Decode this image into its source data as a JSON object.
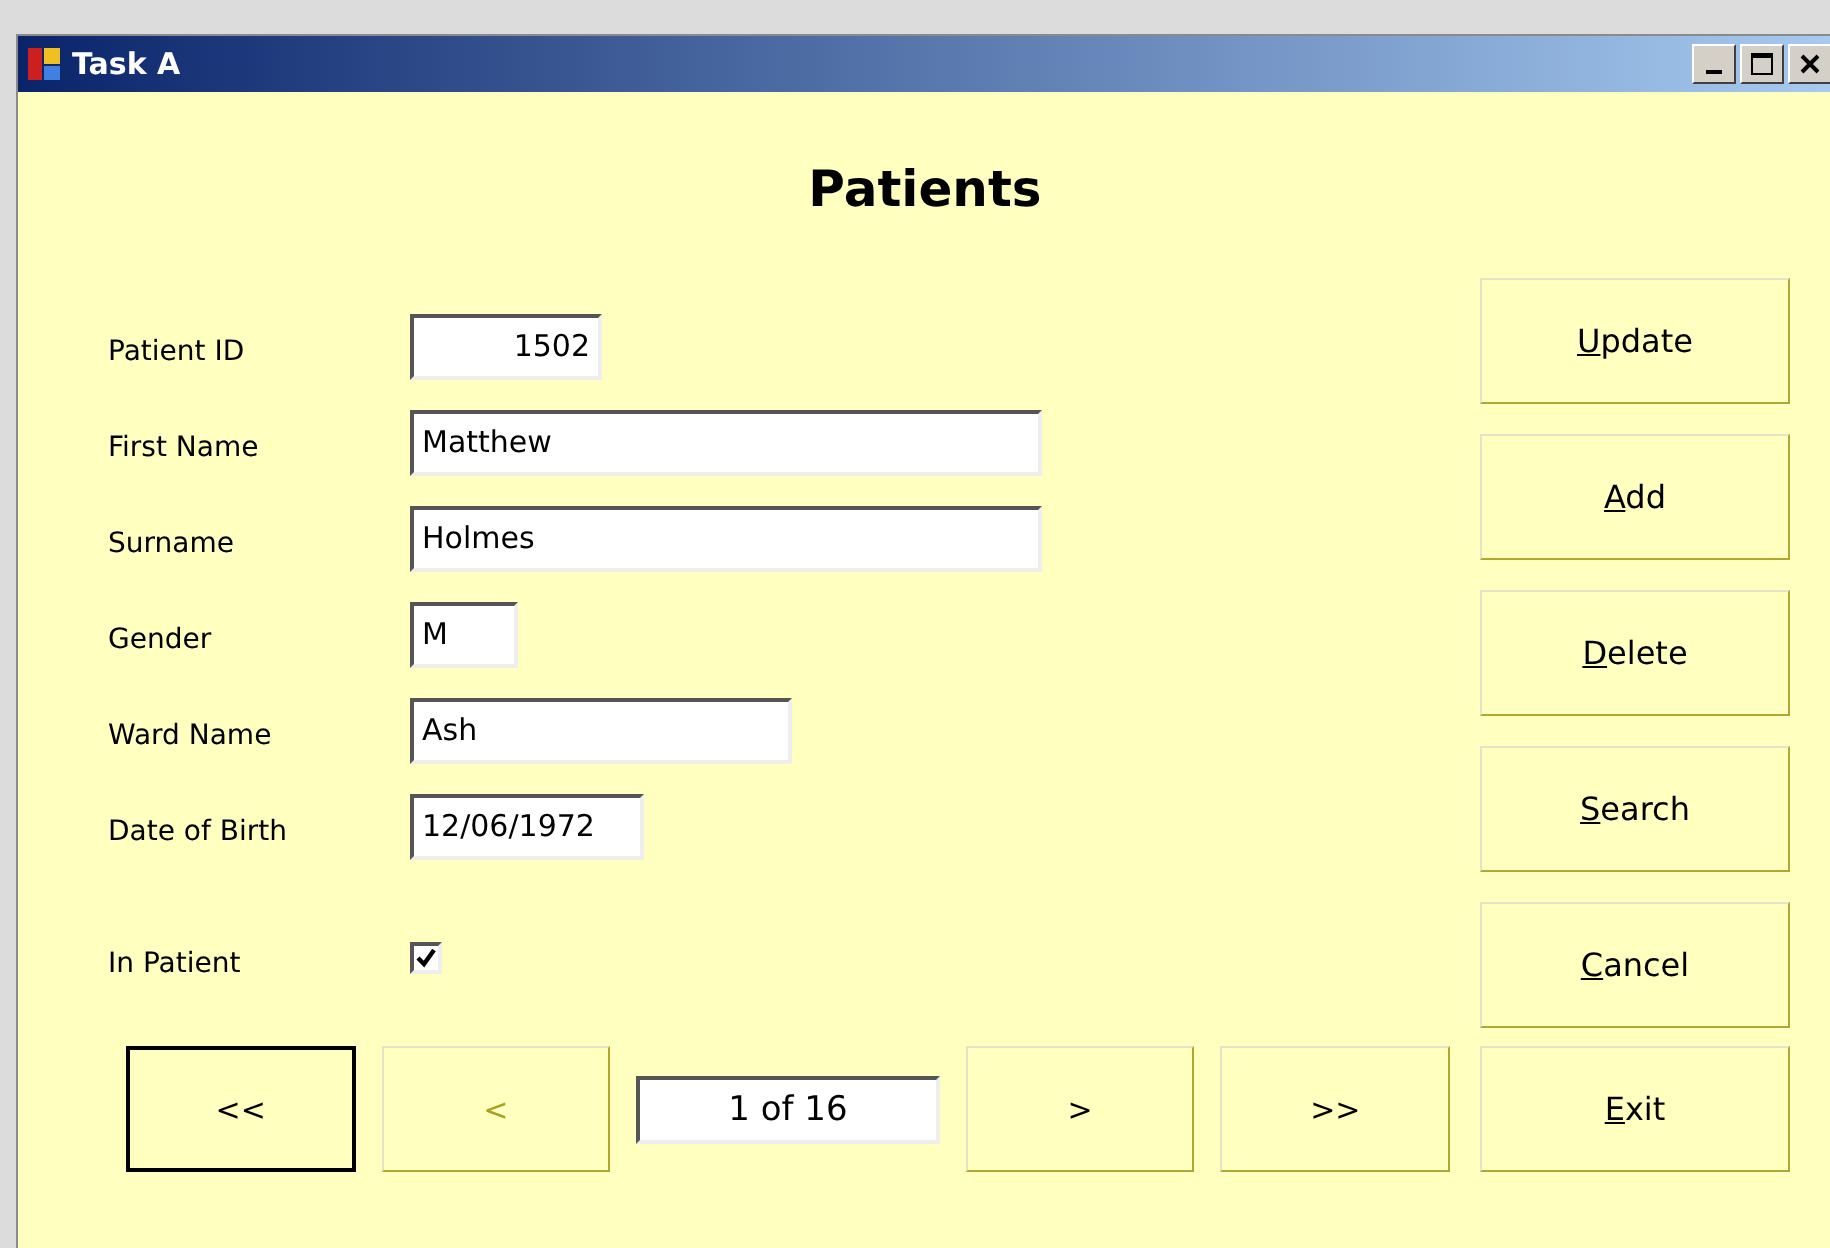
{
  "window": {
    "title": "Task A"
  },
  "heading": "Patients",
  "fields": [
    {
      "label": "Patient ID",
      "value": "1502",
      "kind": "number"
    },
    {
      "label": "First Name",
      "value": "Matthew",
      "kind": "long"
    },
    {
      "label": "Surname",
      "value": "Holmes",
      "kind": "long"
    },
    {
      "label": "Gender",
      "value": "M",
      "kind": "tiny"
    },
    {
      "label": "Ward Name",
      "value": "Ash",
      "kind": "medium"
    },
    {
      "label": "Date of Birth",
      "value": "12/06/1972",
      "kind": "short"
    }
  ],
  "in_patient": {
    "label": "In Patient",
    "checked": true
  },
  "navigation": [
    {
      "label": "<<",
      "disabled": false,
      "focused": true
    },
    {
      "label": "<",
      "disabled": true,
      "focused": false
    },
    {
      "label": ">",
      "disabled": false,
      "focused": false
    },
    {
      "label": ">>",
      "disabled": false,
      "focused": false
    }
  ],
  "record_counter": "1 of 16",
  "actions": [
    {
      "label": "Update",
      "underline_first": true
    },
    {
      "label": "Add",
      "underline_first": true
    },
    {
      "label": "Delete",
      "underline_first": true
    },
    {
      "label": "Search",
      "underline_first": true
    },
    {
      "label": "Cancel",
      "underline_first": true
    },
    {
      "label": "Exit",
      "underline_first": true
    }
  ]
}
